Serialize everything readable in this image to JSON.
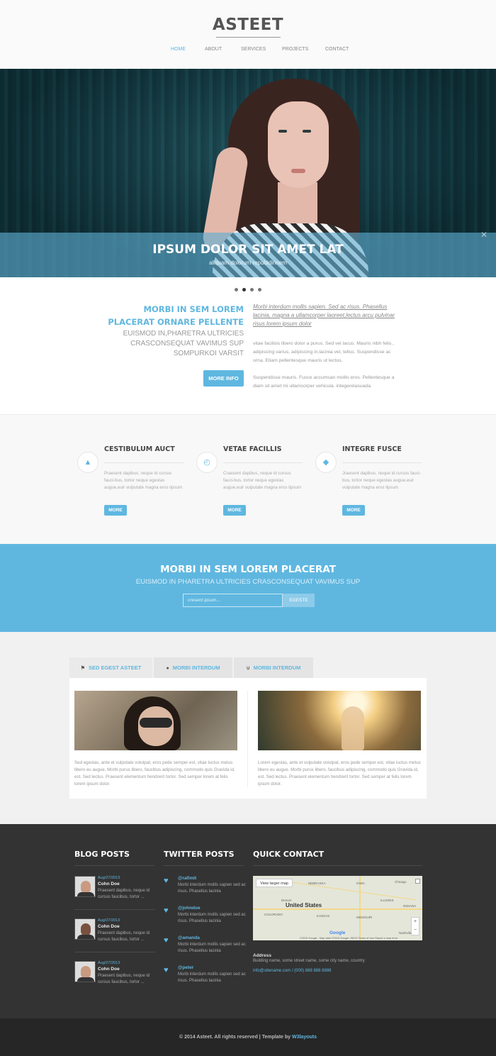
{
  "header": {
    "logo": "ASTEET",
    "nav": [
      {
        "label": "HOME",
        "active": true
      },
      {
        "label": "ABOUT",
        "active": false
      },
      {
        "label": "SERVICES",
        "active": false
      },
      {
        "label": "PROJECTS",
        "active": false
      },
      {
        "label": "CONTACT",
        "active": false
      }
    ]
  },
  "hero": {
    "title": "IPSUM DOLOR SIT AMET LAT",
    "subtitle": "aliquam dolorum repubidinnem",
    "slides_total": 4,
    "active_slide": 2
  },
  "intro": {
    "heading": "MORBI IN SEM LOREM PLACERAT ORNARE PELLENTE",
    "subheading": "EUISMOD IN,PHARETRA ULTRICIES CRASCONSEQUAT VAVIMUS SUP SOMPURKOI VARSIT",
    "button": "MORE INFO",
    "link_text": "Morbi interdum mollis sapien. Sed ac risus. Phasellus lacinia, magna a ullamcorper laoreet,lectus arcu pulvinar risus lorem ipsum dolor",
    "para1": "vitae facilisis libero dolor a purus. Sed vel lacus. Mauris nibh felis., adipiscing varius, adipiscing in,lacinia vel, tellus. Suspendisse ac urna. Etiam pellentesque mauris ut lectus.",
    "para2": "Suspendisse mauris. Fusce accumsan mollis eros. Pellentesque a diam sit amet mi ullamcorper vehicula. integerelasuada."
  },
  "features": [
    {
      "icon": "user-icon",
      "title": "CESTIBULUM AUCT",
      "text": "Praesent dapibus, neque id cursus fauci-bus, tortor neque egestas augue,euir vulputate magna eros lipsum",
      "button": "MORE"
    },
    {
      "icon": "clock-icon",
      "title": "VETAE FACILLIS",
      "text": "Craesent dapibus, neque id cursus fauci-bus, tortor neque egestas augue,euir vulputate magna eros lipsum",
      "button": "MORE"
    },
    {
      "icon": "tag-icon",
      "title": "INTEGRE FUSCE",
      "text": "Jraesent dapibus, neque id cursus fauci-bus, tortor neque egestas augue,euir vulputate magna eros lipsum",
      "button": "MORE"
    }
  ],
  "band": {
    "title": "MORBI IN SEM LOREM PLACERAT",
    "subtitle": "EUISMOD IN PHARETRA ULTRICIES CRASCONSEQUAT VAVIMUS SUP",
    "input_placeholder": "cresent ipsum...",
    "button": "EGESTE"
  },
  "tabs": [
    {
      "icon": "flag-icon",
      "label": "SED EGEST ASTEET",
      "active": true
    },
    {
      "icon": "drop-icon",
      "label": "MORBI INTERDUM",
      "active": false
    },
    {
      "icon": "magnet-icon",
      "label": "MORBI INTERDUM",
      "active": false
    }
  ],
  "tab_panel": [
    {
      "text": "Sed egestas, ante et vulputate volutpat, eros pede semper est, vitae luctus metus libero eu augue. Morbi purus libero, faucibus adipiscing, commodo quis Gravida id, est. Sed lectus. Praesent elementum hendrerit tortor. Sed semper lorem at felis lorem ipsum dolor."
    },
    {
      "text": "Lorem egestas, ante et vulputate volutpat, eros pede semper est, vitae luctus metus libero eu augue. Morbi purus libero, faucibus adipiscing, commodo quis Gravida id, est. Sed lectus. Praesent elementum hendrerit tortor. Sed semper at felis lorem ipsum dolor."
    }
  ],
  "footer": {
    "blog_title": "BLOG POSTS",
    "twitter_title": "TWITTER POSTS",
    "contact_title": "QUICK CONTACT",
    "blog_posts": [
      {
        "date": "Aug/27/2013",
        "name": "Cohn Doe",
        "text": "Praesent dapibus, neque id cursus faucibus, tortor ..."
      },
      {
        "date": "Aug/27/2013",
        "name": "Cohn Doe",
        "text": "Praesent dapibus, neque id cursus faucibus, tortor ..."
      },
      {
        "date": "Aug/27/2013",
        "name": "Cohn Doe",
        "text": "Praesent dapibus, neque id cursus faucibus, tortor ..."
      }
    ],
    "tweets": [
      {
        "user": "@rafimit",
        "text": "Morbi interdum mollis sapien sed ac risus. Phasellus lacinia"
      },
      {
        "user": "@johndoe",
        "text": "Morbi interdum mollis sapien sed ac risus. Phasellus lacinia"
      },
      {
        "user": "@amanda",
        "text": "Morbi interdum mollis sapien sed ac risus. Phasellus lacinia"
      },
      {
        "user": "@peter",
        "text": "Morbi interdum mollis sapien sed ac risus. Phasellus lacinia"
      }
    ],
    "map": {
      "larger_map": "View larger map",
      "country": "United States",
      "labels": [
        "NEBRASKA",
        "IOWA",
        "Chicago",
        "Denver",
        "ILLINOIS",
        "INDIANA",
        "COLORADO",
        "KANSAS",
        "MISSOURI",
        "Nashville"
      ],
      "brand": "Google",
      "footer": "©2015 Google - Map data ©2015 Google, INEGI   Terms of Use   Report a map error"
    },
    "address_title": "Address",
    "address_text": "Building name, some street name, some city name, country",
    "contact_line": "info@sitename.com / (000) 888 888 8888"
  },
  "copyright": {
    "text": "© 2014 Asteet. All rights reserved | Template by ",
    "brand": "W3layouts"
  },
  "colors": {
    "accent": "#5fb7e0",
    "footer_bg": "#333333",
    "copyright_bg": "#262626"
  }
}
